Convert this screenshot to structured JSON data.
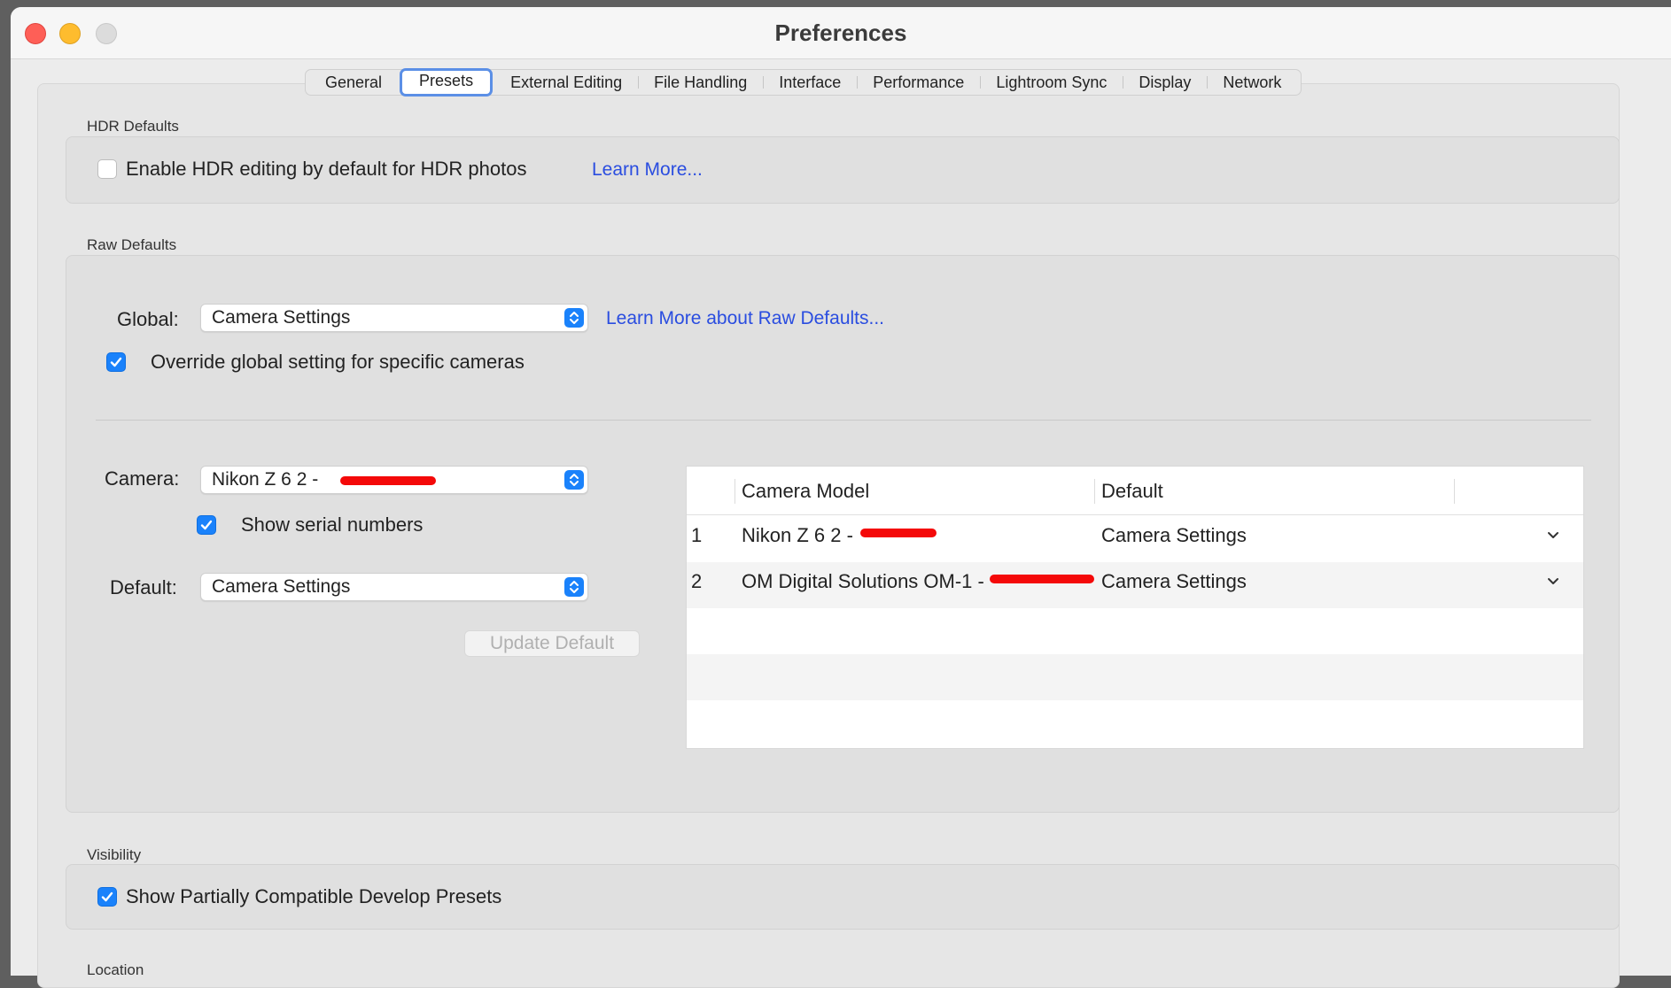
{
  "window": {
    "title": "Preferences"
  },
  "tabs": [
    {
      "label": "General",
      "active": false
    },
    {
      "label": "Presets",
      "active": true
    },
    {
      "label": "External Editing",
      "active": false
    },
    {
      "label": "File Handling",
      "active": false
    },
    {
      "label": "Interface",
      "active": false
    },
    {
      "label": "Performance",
      "active": false
    },
    {
      "label": "Lightroom Sync",
      "active": false
    },
    {
      "label": "Display",
      "active": false
    },
    {
      "label": "Network",
      "active": false
    }
  ],
  "hdr": {
    "section_label": "HDR Defaults",
    "checkbox_label": "Enable HDR editing by default for HDR photos",
    "checked": false,
    "link": "Learn More..."
  },
  "raw": {
    "section_label": "Raw Defaults",
    "global_label": "Global:",
    "global_value": "Camera Settings",
    "global_link": "Learn More about Raw Defaults...",
    "override_label": "Override global setting for specific cameras",
    "override_checked": true,
    "camera_label": "Camera:",
    "camera_value": "Nikon Z 6 2 -",
    "show_serial_label": "Show serial numbers",
    "show_serial_checked": true,
    "default_label": "Default:",
    "default_value": "Camera Settings",
    "update_button": "Update Default",
    "table": {
      "columns": [
        "Camera Model",
        "Default"
      ],
      "rows": [
        {
          "index": "1",
          "model": "Nikon Z 6 2 -",
          "default": "Camera Settings"
        },
        {
          "index": "2",
          "model": "OM Digital Solutions OM-1 -",
          "default": "Camera Settings"
        }
      ]
    }
  },
  "visibility": {
    "section_label": "Visibility",
    "checkbox_label": "Show Partially Compatible Develop Presets",
    "checked": true
  },
  "location": {
    "section_label": "Location"
  },
  "colors": {
    "accent": "#1a82fb",
    "link": "#2a4de0",
    "redaction": "#f40909",
    "tab_focus": "#5b8fe6"
  }
}
